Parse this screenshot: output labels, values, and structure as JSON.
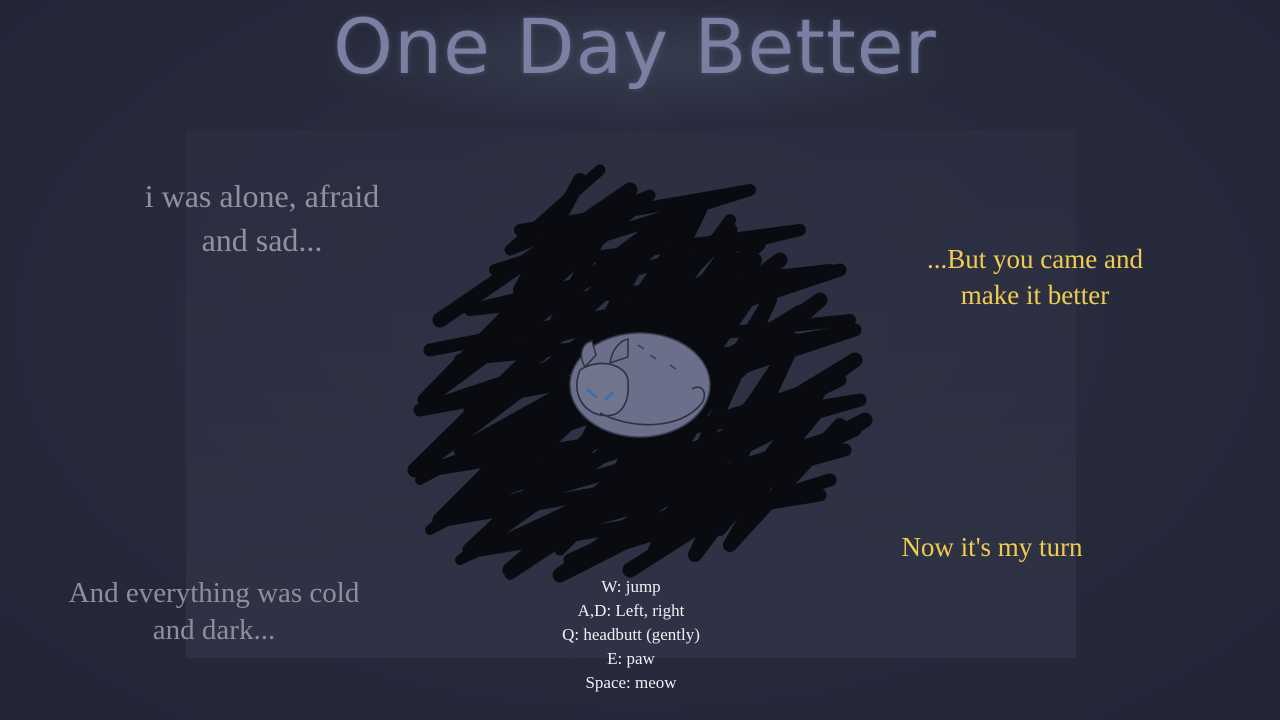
{
  "game": {
    "title": "One Day Better",
    "story": {
      "alone": [
        "i was alone, afraid",
        "and sad..."
      ],
      "cold": [
        "And everything was cold",
        "and dark..."
      ],
      "came": [
        "...But you came and",
        "make it better"
      ],
      "turn": "Now it's my turn"
    },
    "controls": [
      "W: jump",
      "A,D: Left, right",
      "Q: headbutt (gently)",
      "E: paw",
      "Space: meow"
    ]
  },
  "colors": {
    "background": "#252839",
    "title": "#7a80a2",
    "sad_text": "#8f939f",
    "hope_text": "#f0cc52",
    "controls_text": "#eef0f4",
    "scribble": "#08090d",
    "cat_fill": "#6b6f89",
    "cat_tears": "#3e6fa8"
  },
  "icons": {
    "scene": "scribble-cloud-with-sleeping-cat"
  }
}
